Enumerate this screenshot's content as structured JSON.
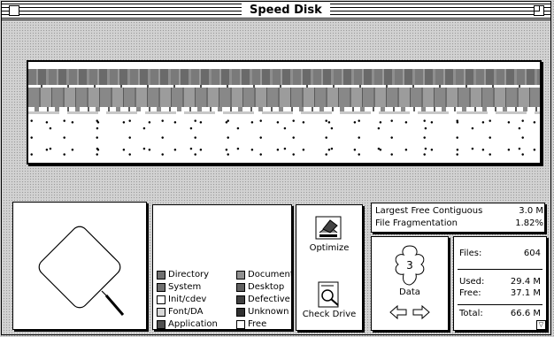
{
  "window": {
    "title": "Speed Disk"
  },
  "legend": {
    "left": [
      "Directory",
      "System",
      "Init/cdev",
      "Font/DA",
      "Application"
    ],
    "right": [
      "Document",
      "Desktop",
      "Defective",
      "Unknown",
      "Free"
    ],
    "left_colors": [
      "#707070",
      "#707070",
      "#ffffff",
      "#d8d8d8",
      "#505050"
    ],
    "right_colors": [
      "#909090",
      "#606060",
      "#404040",
      "#303030",
      "#ffffff"
    ]
  },
  "buttons": {
    "optimize": "Optimize",
    "check_drive": "Check Drive"
  },
  "stats": {
    "largest_free_label": "Largest Free Contiguous",
    "largest_free_value": "3.0 M",
    "fragmentation_label": "File Fragmentation",
    "fragmentation_value": "1.82%"
  },
  "drive": {
    "number": "3",
    "name": "Data"
  },
  "files": {
    "files_label": "Files:",
    "files_value": "604",
    "used_label": "Used:",
    "used_value": "29.4 M",
    "free_label": "Free:",
    "free_value": "37.1 M",
    "total_label": "Total:",
    "total_value": "66.6 M"
  },
  "colors": {
    "used_block": "#8a8a8a",
    "dark_block": "#555555",
    "free_block": "#ffffff"
  }
}
